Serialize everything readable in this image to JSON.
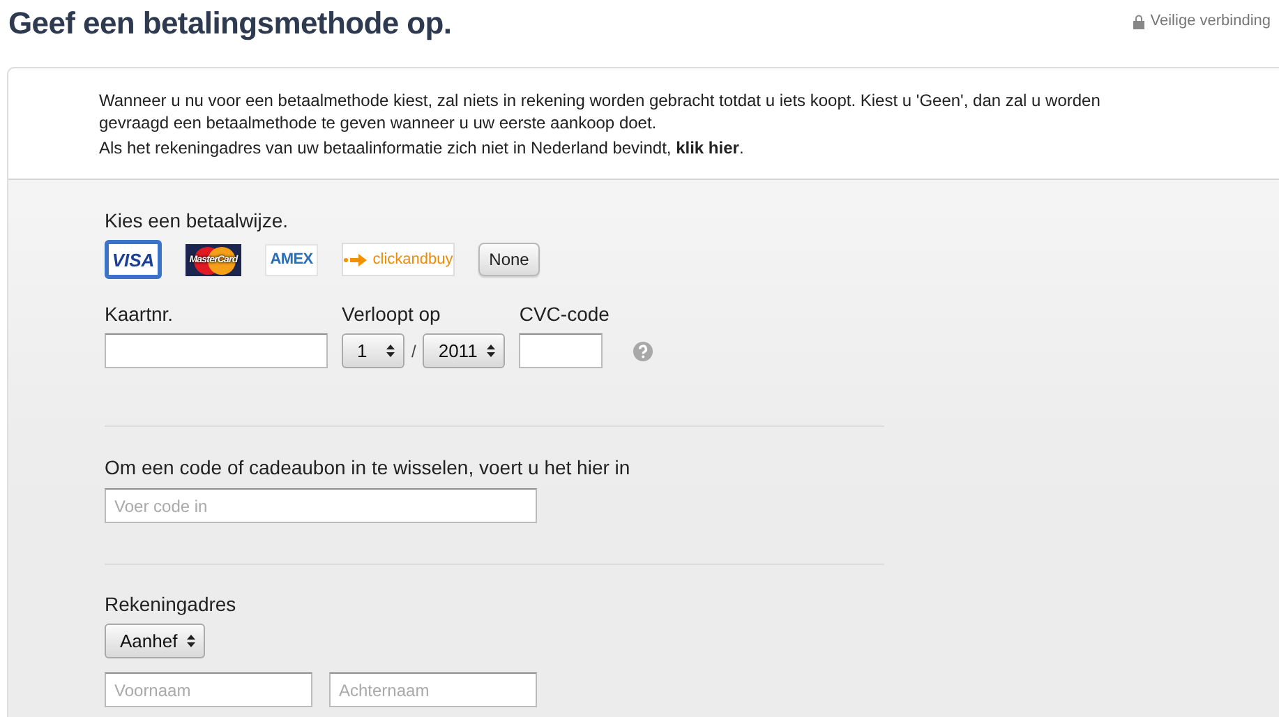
{
  "header": {
    "title": "Geef een betalingsmethode op.",
    "secure_label": "Veilige verbinding"
  },
  "notice": {
    "text": "Wanneer u nu voor een betaalmethode kiest, zal niets in rekening worden gebracht totdat u iets koopt. Kiest u 'Geen', dan zal u worden gevraagd een betaalmethode te geven wanneer u uw eerste aankoop doet.",
    "country_text": "Als het rekeningadres van uw betaalinformatie zich niet in Nederland bevindt,",
    "country_link": "klik hier",
    "country_end": "."
  },
  "payment": {
    "label": "Kies een betaalwijze.",
    "methods": [
      {
        "kind": "visa",
        "label": "VISA",
        "selected": true
      },
      {
        "kind": "mastercard",
        "label": "MasterCard",
        "selected": false
      },
      {
        "kind": "amex",
        "label": "AMEX",
        "selected": false
      },
      {
        "kind": "clickandbuy",
        "label": "clickandbuy",
        "selected": false
      },
      {
        "kind": "none",
        "label": "None",
        "selected": false
      }
    ]
  },
  "card": {
    "number_label": "Kaartnr.",
    "expiry_label": "Verloopt op",
    "month": "1",
    "separator": "/",
    "year": "2011",
    "cvc_label": "CVC-code"
  },
  "code": {
    "label": "Om een code of cadeaubon in te wisselen, voert u het hier in",
    "placeholder": "Voer code in"
  },
  "address": {
    "label": "Rekeningadres",
    "salutation": "Aanhef",
    "first_name_placeholder": "Voornaam",
    "last_name_placeholder": "Achternaam"
  }
}
